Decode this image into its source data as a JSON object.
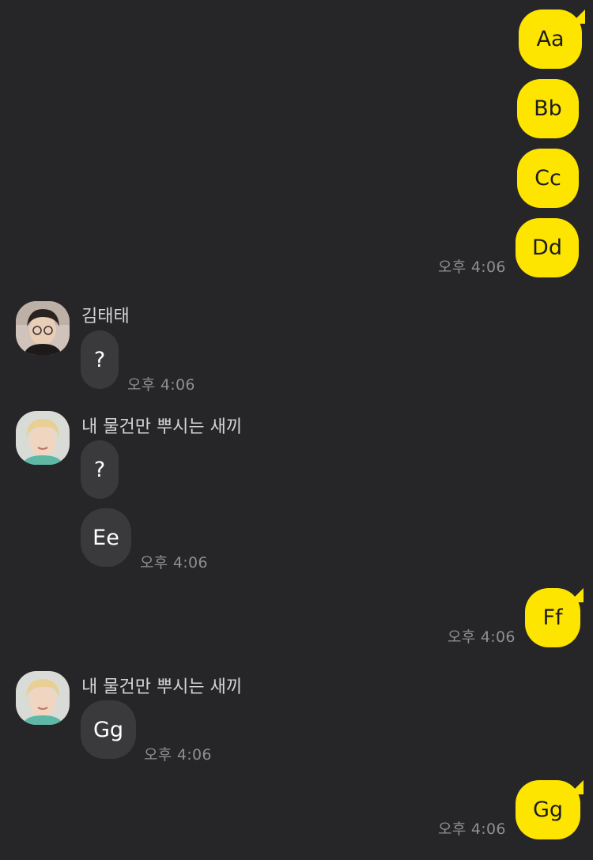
{
  "colors": {
    "background": "#262628",
    "my_bubble": "#FEE500",
    "other_bubble": "#3a3a3c",
    "time_text": "#8e8e93",
    "name_text": "#d4d4d6"
  },
  "messages": {
    "m1": {
      "text": "Aa"
    },
    "m2": {
      "text": "Bb"
    },
    "m3": {
      "text": "Cc"
    },
    "m4": {
      "text": "Dd",
      "time": "오후 4:06"
    },
    "g1": {
      "sender": "김태태",
      "avatar": "profile-photo-dark-hair-glasses",
      "m1": {
        "text": "?",
        "time": "오후 4:06"
      }
    },
    "g2": {
      "sender": "내 물건만 뿌시는 새끼",
      "avatar": "profile-photo-blonde-hair",
      "m1": {
        "text": "?"
      },
      "m2": {
        "text": "Ee",
        "time": "오후 4:06"
      }
    },
    "m5": {
      "text": "Ff",
      "time": "오후 4:06"
    },
    "g3": {
      "sender": "내 물건만 뿌시는 새끼",
      "avatar": "profile-photo-blonde-hair",
      "m1": {
        "text": "Gg",
        "time": "오후 4:06"
      }
    },
    "m6": {
      "text": "Gg",
      "time": "오후 4:06"
    }
  }
}
